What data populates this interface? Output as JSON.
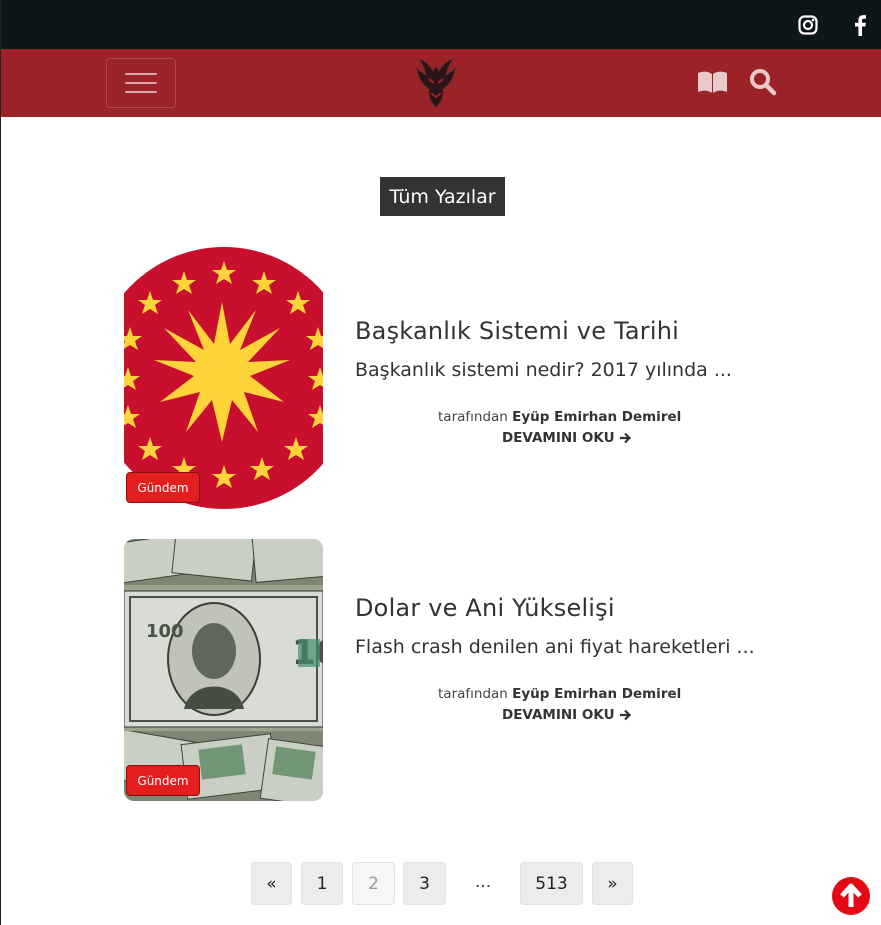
{
  "header": {
    "social": [
      "instagram-icon",
      "facebook-icon"
    ],
    "nav_icons": [
      "book-icon",
      "search-icon"
    ],
    "colors": {
      "topbar": "#0d1719",
      "navbar": "#9b2226",
      "accent": "#e41e1e"
    }
  },
  "main": {
    "section_title": "Tüm Yazılar",
    "posts": [
      {
        "title": "Başkanlık Sistemi ve Tarihi",
        "excerpt": "Başkanlık sistemi nedir? 2017 yılında ...",
        "by_label": "tarafından",
        "author": "Eyüp Emirhan Demirel",
        "read_more": "DEVAMINI OKU",
        "category": "Gündem",
        "image": "presidential-seal-image"
      },
      {
        "title": "Dolar ve Ani Yükselişi",
        "excerpt": "Flash crash denilen ani fiyat hareketleri ...",
        "by_label": "tarafından",
        "author": "Eyüp Emirhan Demirel",
        "read_more": "DEVAMINI OKU",
        "category": "Gündem",
        "image": "dollar-bills-image"
      }
    ]
  },
  "pagination": {
    "prev": "«",
    "pages": [
      "1",
      "2",
      "3"
    ],
    "current": "2",
    "ellipsis": "...",
    "last": "513",
    "next": "»"
  }
}
